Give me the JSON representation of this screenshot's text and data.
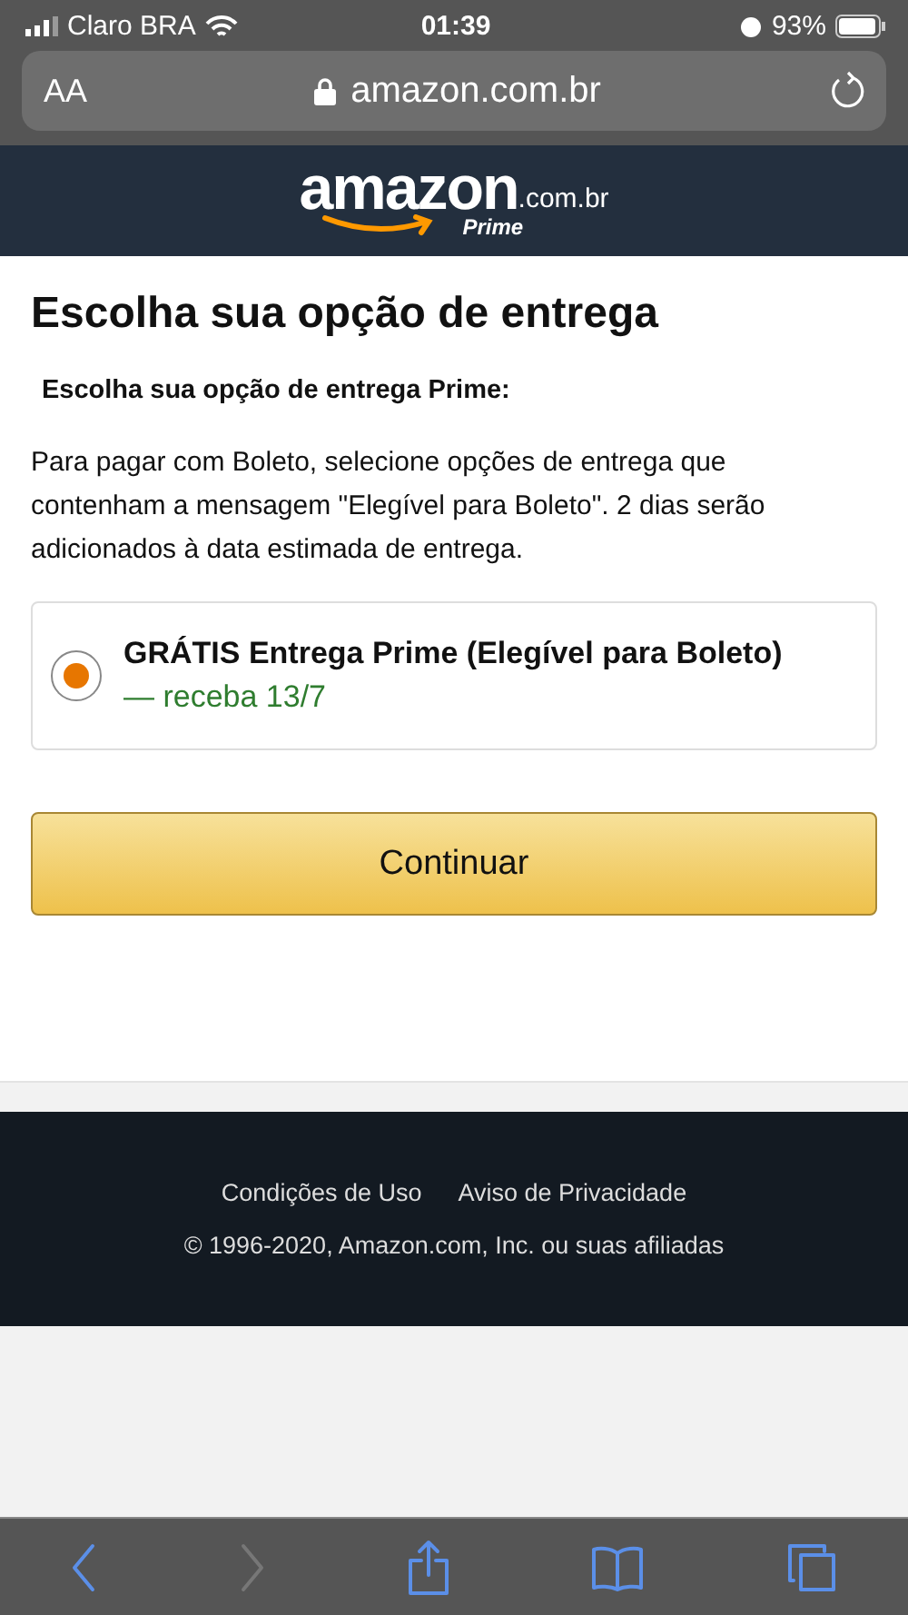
{
  "status_bar": {
    "carrier": "Claro BRA",
    "time": "01:39",
    "battery": "93%"
  },
  "address_bar": {
    "text_size": "AA",
    "url": "amazon.com.br"
  },
  "header": {
    "logo": "amazon",
    "domain": ".com.br",
    "program": "Prime"
  },
  "page": {
    "title": "Escolha sua opção de entrega",
    "subtitle": "Escolha sua opção de entrega Prime:",
    "notice": "Para pagar com Boleto, selecione opções de entrega que contenham a mensagem \"Elegível para Boleto\". 2 dias serão adicionados à data estimada de entrega.",
    "options": [
      {
        "title": "GRÁTIS Entrega Prime (Elegível para Boleto)",
        "date": "— receba 13/7",
        "selected": true
      }
    ],
    "button": "Continuar"
  },
  "footer": {
    "links": [
      "Condições de Uso",
      "Aviso de Privacidade"
    ],
    "copyright": "© 1996-2020, Amazon.com, Inc. ou suas afiliadas"
  },
  "toolbar": [
    {
      "kind": "back",
      "disabled": false
    },
    {
      "kind": "forward",
      "disabled": true
    },
    {
      "kind": "share",
      "disabled": false
    },
    {
      "kind": "bookmarks",
      "disabled": false
    },
    {
      "kind": "tabs",
      "disabled": false
    }
  ]
}
